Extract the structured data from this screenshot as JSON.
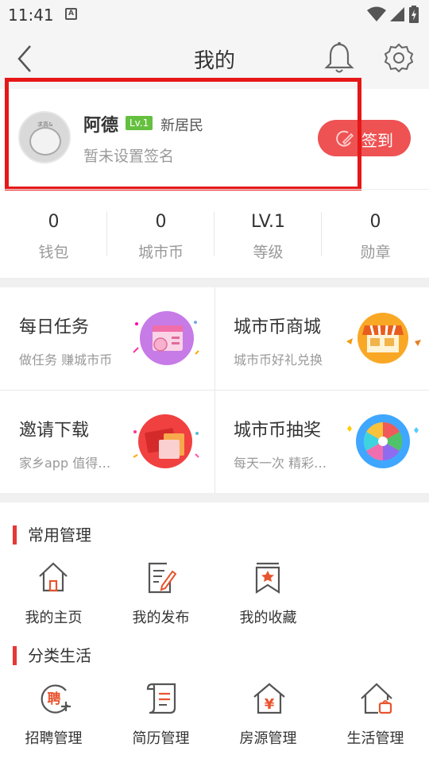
{
  "status_bar": {
    "time": "11:41",
    "notif_glyph": "A",
    "icons": [
      "notification-icon",
      "wifi-icon",
      "signal-icon",
      "battery-icon"
    ]
  },
  "header": {
    "title": "我的",
    "icons": [
      "back-arrow-icon",
      "bell-icon",
      "gear-icon"
    ]
  },
  "profile": {
    "name": "阿德",
    "level_badge": "Lv.1",
    "rank": "新居民",
    "signature": "暂未设置签名",
    "signin_label": "签到",
    "avatar_caption": "求真&",
    "accent_color": "#ee5253",
    "highlight_color": "#e61717"
  },
  "stats": [
    {
      "value": "0",
      "label": "钱包"
    },
    {
      "value": "0",
      "label": "城市币"
    },
    {
      "value": "LV.1",
      "label": "等级"
    },
    {
      "value": "0",
      "label": "勋章"
    }
  ],
  "features": [
    {
      "title": "每日任务",
      "subtitle": "做任务 赚城市币",
      "icon": "daily-task-icon"
    },
    {
      "title": "城市币商城",
      "subtitle": "城市币好礼兑换",
      "icon": "shop-icon"
    },
    {
      "title": "邀请下载",
      "subtitle": "家乡app 值得…",
      "icon": "red-envelope-icon"
    },
    {
      "title": "城市币抽奖",
      "subtitle": "每天一次 精彩…",
      "icon": "lucky-wheel-icon"
    }
  ],
  "common_section": {
    "title": "常用管理",
    "items": [
      {
        "label": "我的主页",
        "icon": "home-icon"
      },
      {
        "label": "我的发布",
        "icon": "edit-document-icon"
      },
      {
        "label": "我的收藏",
        "icon": "bookmark-star-icon"
      }
    ]
  },
  "category_section": {
    "title": "分类生活",
    "items": [
      {
        "label": "招聘管理",
        "icon": "recruit-icon",
        "glyph": "聘"
      },
      {
        "label": "简历管理",
        "icon": "resume-icon"
      },
      {
        "label": "房源管理",
        "icon": "house-listing-icon",
        "glyph": "¥"
      },
      {
        "label": "生活管理",
        "icon": "life-house-icon"
      }
    ]
  }
}
